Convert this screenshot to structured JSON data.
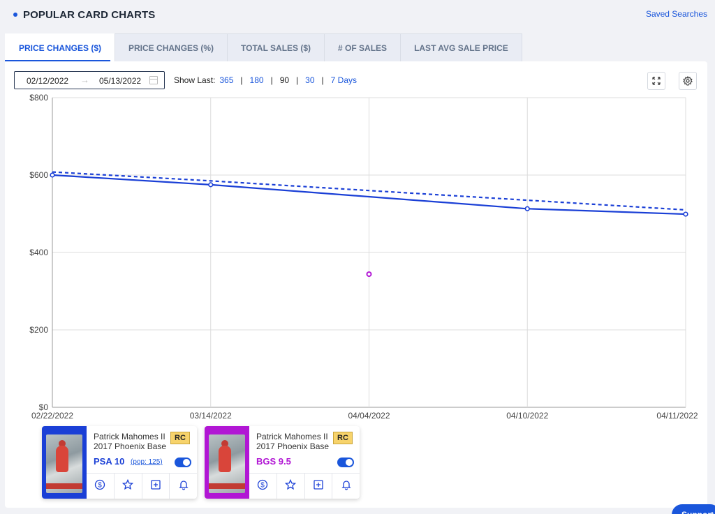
{
  "header": {
    "title": "POPULAR CARD CHARTS",
    "saved_searches": "Saved Searches"
  },
  "tabs": [
    {
      "label": "PRICE CHANGES ($)",
      "active": true
    },
    {
      "label": "PRICE CHANGES (%)",
      "active": false
    },
    {
      "label": "TOTAL SALES ($)",
      "active": false
    },
    {
      "label": "# OF SALES",
      "active": false
    },
    {
      "label": "LAST AVG SALE PRICE",
      "active": false
    }
  ],
  "toolbar": {
    "date_from": "02/12/2022",
    "date_to": "05/13/2022",
    "arrow": "→",
    "show_last_label": "Show Last:",
    "show_last_options": [
      "365",
      "180",
      "90",
      "30",
      "7 Days"
    ],
    "show_last_current": "90",
    "fullscreen_icon": "fullscreen-icon",
    "settings_icon": "gear-icon"
  },
  "chart_data": {
    "type": "line",
    "x": [
      "02/22/2022",
      "03/14/2022",
      "04/04/2022",
      "04/10/2022",
      "04/11/2022"
    ],
    "ylim": [
      0,
      800
    ],
    "yticks": [
      "$0",
      "$200",
      "$400",
      "$600",
      "$800"
    ],
    "grid": true,
    "series": [
      {
        "values": [
          600,
          575,
          null,
          513,
          499
        ],
        "color": "#1a3fd6",
        "style": "solid"
      },
      {
        "values": [
          608,
          585,
          560,
          535,
          510
        ],
        "color": "#1a3fd6",
        "style": "dashed"
      },
      {
        "values": [
          null,
          null,
          344,
          null,
          null
        ],
        "color": "#b116d4",
        "style": "point"
      }
    ]
  },
  "cards": [
    {
      "name": "Patrick Mahomes II",
      "set": "2017 Phoenix Base",
      "badge": "RC",
      "grade": "PSA 10",
      "pop": "(pop: 125)",
      "accent": "#1a3fd6",
      "grade_color": "#1a3fd6",
      "toggle_on": true
    },
    {
      "name": "Patrick Mahomes II",
      "set": "2017 Phoenix Base",
      "badge": "RC",
      "grade": "BGS 9.5",
      "pop": "",
      "accent": "#b116d4",
      "grade_color": "#b116d4",
      "toggle_on": true
    }
  ],
  "card_actions": [
    "dollar-icon",
    "star-icon",
    "plus-square-icon",
    "bell-icon"
  ],
  "support": {
    "label": "Support"
  }
}
